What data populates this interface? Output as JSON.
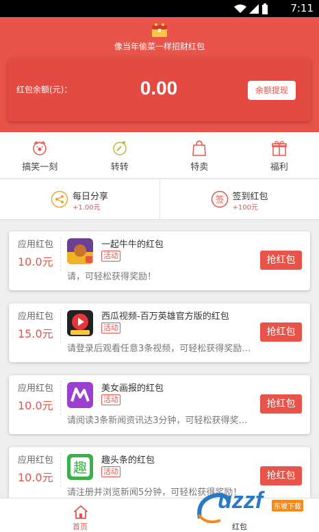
{
  "status_bar": {
    "time": "7:11"
  },
  "header": {
    "slogan": "像当年偷菜一样招财红包"
  },
  "balance": {
    "label": "红包余额(元)：",
    "amount": "0.00",
    "withdraw_label": "余额提现"
  },
  "nav": [
    {
      "label": "搞笑一刻",
      "icon": "clown-icon"
    },
    {
      "label": "转转",
      "icon": "spin-icon"
    },
    {
      "label": "特卖",
      "icon": "shopping-bag-icon"
    },
    {
      "label": "福利",
      "icon": "gift-icon"
    }
  ],
  "tasks": [
    {
      "title": "每日分享",
      "reward": "+1.00元",
      "icon": "share-icon"
    },
    {
      "title": "签到红包",
      "reward": "+100元",
      "icon": "checkin-icon",
      "icon_text": "签"
    }
  ],
  "cards": [
    {
      "type": "应用红包",
      "value": "10.0元",
      "name": "一起牛牛的红包",
      "tag": "活动",
      "desc": "请，可轻松获得奖励！",
      "button": "抢红包",
      "icon": "niuniu-app-icon"
    },
    {
      "type": "应用红包",
      "value": "15.0元",
      "name": "西瓜视频-百万英雄官方版的红包",
      "tag": "活动",
      "desc": "请登录后观看任意3条视频，可轻松获得奖励…",
      "button": "抢红包",
      "icon": "xigua-video-app-icon"
    },
    {
      "type": "应用红包",
      "value": "10.0元",
      "name": "美女画报的红包",
      "tag": "活动",
      "desc": "请阅读3条新闻资讯达3分钟，可轻松获得奖…",
      "button": "抢红包",
      "icon": "meinv-huabao-app-icon"
    },
    {
      "type": "应用红包",
      "value": "10.0元",
      "name": "趣头条的红包",
      "tag": "活动",
      "desc": "请注册并浏览新闻5分钟，可轻松获得奖励！",
      "button": "抢红包",
      "icon": "qutoutiao-app-icon",
      "icon_text": "趣"
    }
  ],
  "tabbar": {
    "home_label": "首页",
    "redpacket_label": "红包"
  },
  "watermark": {
    "text": "uzzf",
    "sub": "东坡下载"
  },
  "colors": {
    "primary": "#e8534a",
    "card_bg": "#e24a42"
  }
}
